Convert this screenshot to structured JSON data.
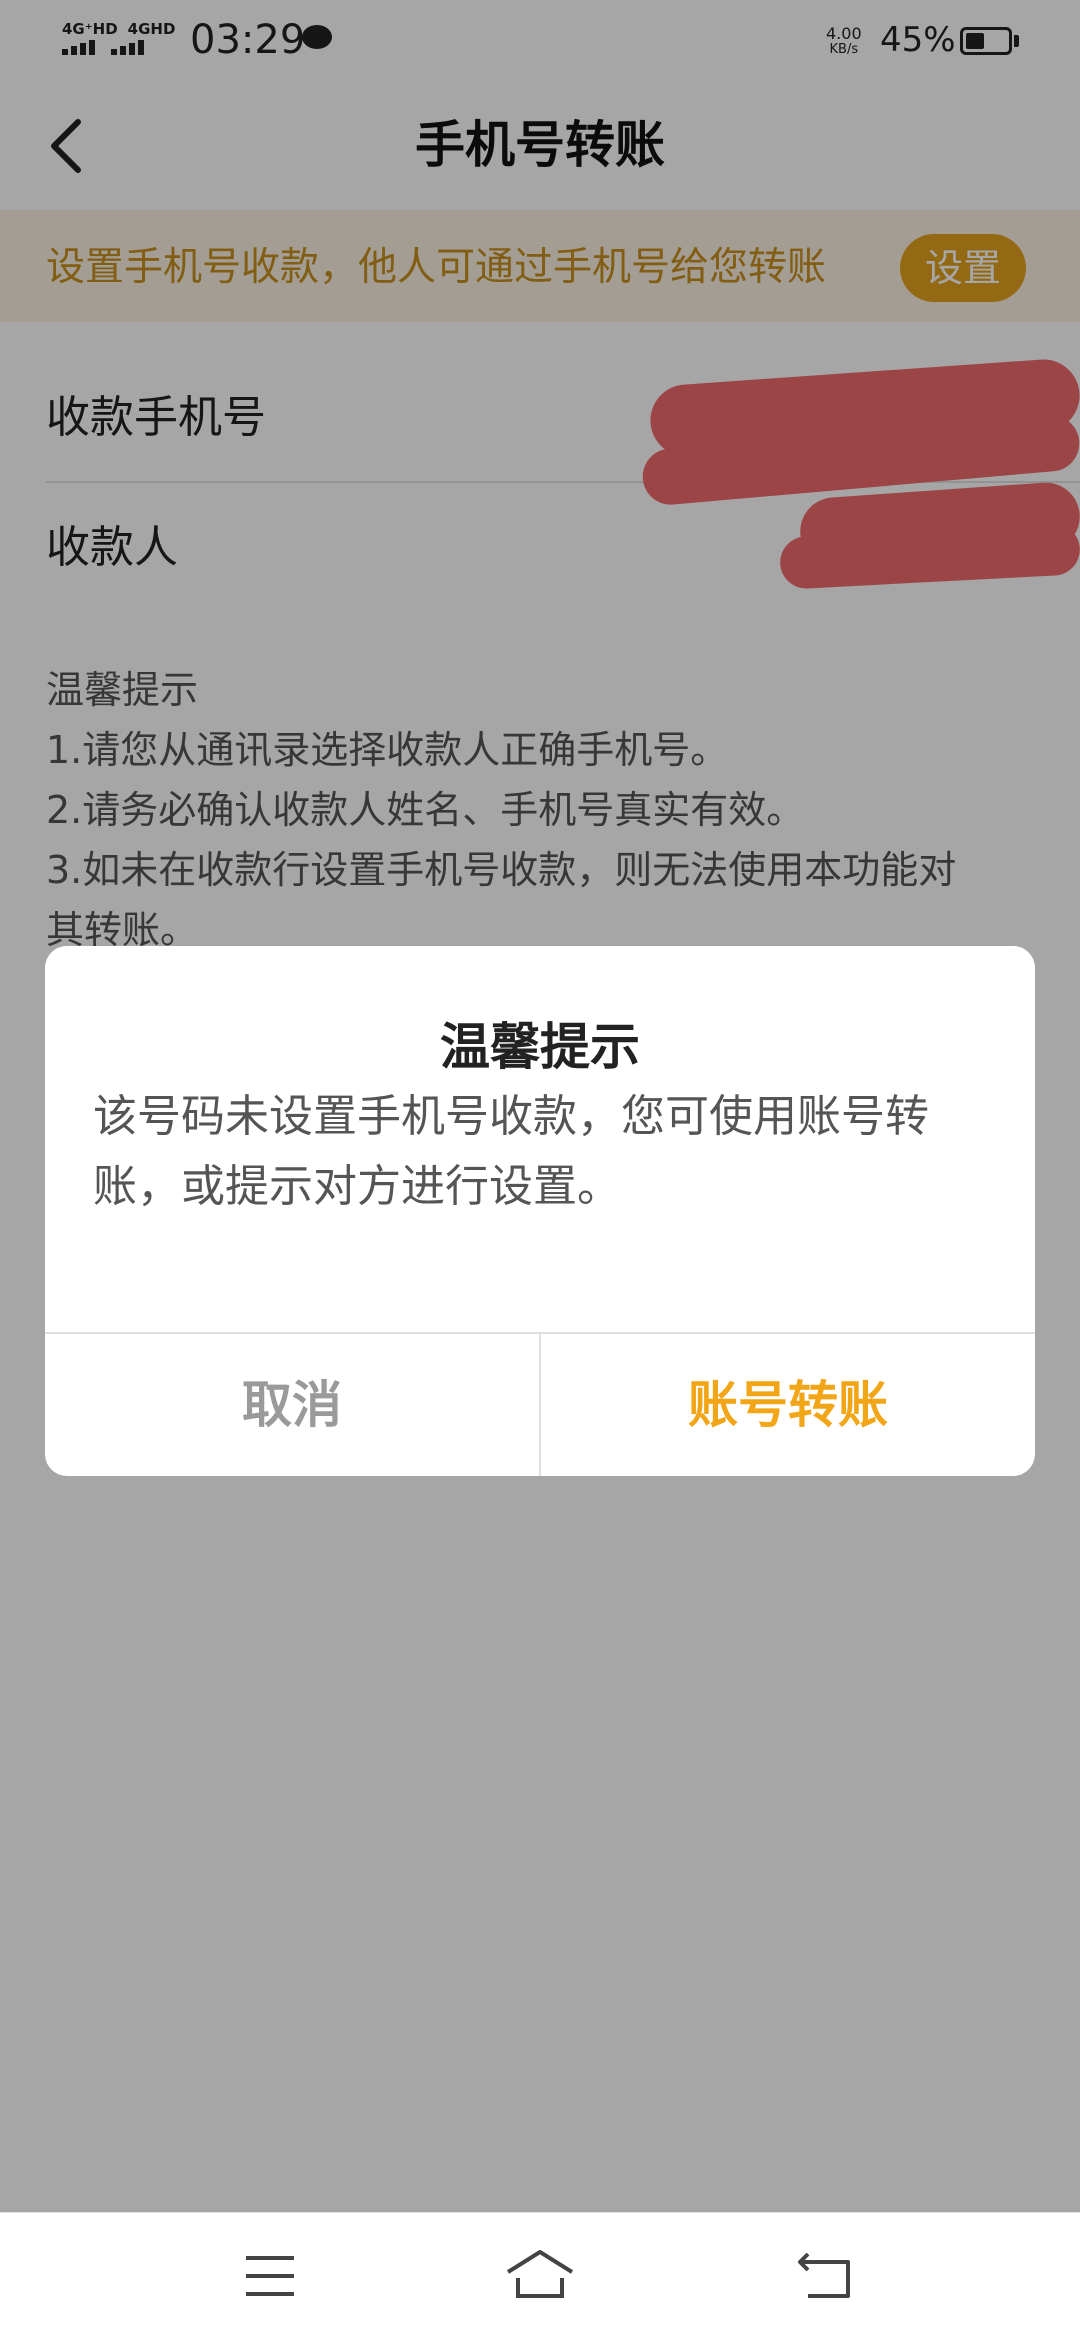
{
  "status_bar": {
    "network_1": "4G⁺HD",
    "network_2": "4GHD",
    "time": "03:29",
    "speed_value": "4.00",
    "speed_unit": "KB/s",
    "battery": "45%",
    "battery_level": 0.45
  },
  "header": {
    "title": "手机号转账",
    "back_icon": "chevron-left-icon"
  },
  "notice": {
    "text": "设置手机号收款，他人可通过手机号给您转账",
    "button_label": "设置"
  },
  "form": {
    "phone_label": "收款手机号",
    "payee_label": "收款人"
  },
  "tips": {
    "title": "温馨提示",
    "line1": "1.请您从通讯录选择收款人正确手机号。",
    "line2": "2.请务必确认收款人姓名、手机号真实有效。",
    "line3a": "3.如未在收款行设置手机号收款，则无法使用本功能对",
    "line3b": "其转账。"
  },
  "dialog": {
    "title": "温馨提示",
    "message_line1": "该号码未设置手机号收款，您可使用账号转",
    "message_line2": "账，或提示对方进行设置。",
    "cancel_label": "取消",
    "confirm_label": "账号转账"
  },
  "bottom_nav": {
    "menu_icon": "menu-icon",
    "home_icon": "home-icon",
    "back_icon": "return-icon"
  },
  "colors": {
    "accent": "#f2a516",
    "notice_text": "#c8901f",
    "notice_bg": "#fbf1e2",
    "redaction": "#f06a6e"
  }
}
